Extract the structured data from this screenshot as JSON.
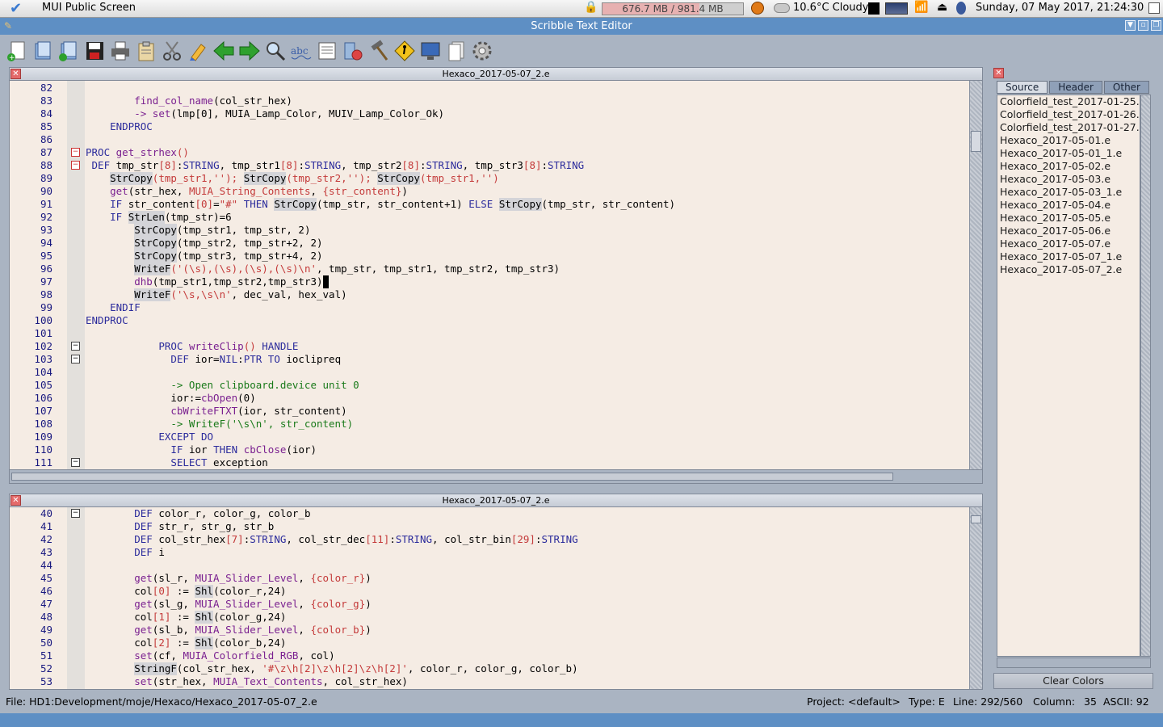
{
  "screen": {
    "title": "MUI Public Screen",
    "memory": "676.7 MB / 981.4 MB",
    "memory_fraction": 0.69,
    "weather": "10.6°C Cloudy",
    "datetime": "Sunday, 07 May 2017, 21:24:30"
  },
  "window": {
    "title": "Scribble Text Editor"
  },
  "toolbar": {
    "buttons": [
      "new-file",
      "open-file",
      "open-add",
      "save",
      "print",
      "paste",
      "cut",
      "highlight",
      "back",
      "forward",
      "find",
      "spell-check",
      "preview",
      "plugins",
      "build",
      "run",
      "monitor",
      "documents",
      "settings"
    ]
  },
  "pane_top": {
    "title": "Hexaco_2017-05-07_2.e",
    "lines": [
      {
        "n": "82",
        "t": []
      },
      {
        "n": "83",
        "t": [
          [
            "",
            "        "
          ],
          [
            "fn",
            "find_col_name"
          ],
          [
            "",
            "(col_str_hex)"
          ]
        ]
      },
      {
        "n": "84",
        "t": [
          [
            "",
            "        "
          ],
          [
            "fn",
            "-> set"
          ],
          [
            "",
            "("
          ],
          [
            "",
            "lmp[0], MUIA_Lamp_Color, MUIV_Lamp_Color_Ok"
          ],
          [
            "",
            ")"
          ]
        ]
      },
      {
        "n": "85",
        "t": [
          [
            "",
            "    "
          ],
          [
            "kw",
            "ENDPROC"
          ]
        ]
      },
      {
        "n": "86",
        "t": []
      },
      {
        "n": "87",
        "t": [
          [
            "kw",
            "PROC"
          ],
          [
            "",
            " "
          ],
          [
            "fn",
            "get_strhex"
          ],
          [
            "str",
            "()"
          ]
        ]
      },
      {
        "n": "88",
        "t": [
          [
            "",
            " "
          ],
          [
            "kw",
            "DEF"
          ],
          [
            "",
            " tmp_str"
          ],
          [
            "str",
            "[8]"
          ],
          [
            "",
            ":"
          ],
          [
            "kw",
            "STRING"
          ],
          [
            "",
            ", tmp_str1"
          ],
          [
            "str",
            "[8]"
          ],
          [
            "",
            ":"
          ],
          [
            "kw",
            "STRING"
          ],
          [
            "",
            ", tmp_str2"
          ],
          [
            "str",
            "[8]"
          ],
          [
            "",
            ":"
          ],
          [
            "kw",
            "STRING"
          ],
          [
            "",
            ", tmp_str3"
          ],
          [
            "str",
            "[8]"
          ],
          [
            "",
            ":"
          ],
          [
            "kw",
            "STRING"
          ]
        ]
      },
      {
        "n": "89",
        "t": [
          [
            "",
            "    "
          ],
          [
            "hl",
            "StrCopy"
          ],
          [
            "str",
            "(tmp_str1,'');"
          ],
          [
            "",
            " "
          ],
          [
            "hl",
            "StrCopy"
          ],
          [
            "str",
            "(tmp_str2,'');"
          ],
          [
            "",
            " "
          ],
          [
            "hl",
            "StrCopy"
          ],
          [
            "str",
            "(tmp_str1,'')"
          ]
        ]
      },
      {
        "n": "90",
        "t": [
          [
            "",
            "    "
          ],
          [
            "fn",
            "get"
          ],
          [
            "",
            "(str_hex, "
          ],
          [
            "str",
            "MUIA_String_Contents"
          ],
          [
            "",
            ", "
          ],
          [
            "str",
            "{str_content}"
          ],
          [
            "",
            ")"
          ]
        ]
      },
      {
        "n": "91",
        "t": [
          [
            "",
            "    "
          ],
          [
            "kw",
            "IF"
          ],
          [
            "",
            " str_content"
          ],
          [
            "str",
            "[0]"
          ],
          [
            "",
            "="
          ],
          [
            "str",
            "\"#\""
          ],
          [
            "",
            " "
          ],
          [
            "kw",
            "THEN"
          ],
          [
            "",
            " "
          ],
          [
            "hl",
            "StrCopy"
          ],
          [
            "",
            "(tmp_str, str_content+1) "
          ],
          [
            "kw",
            "ELSE"
          ],
          [
            "",
            " "
          ],
          [
            "hl",
            "StrCopy"
          ],
          [
            "",
            "(tmp_str, str_content)"
          ]
        ]
      },
      {
        "n": "92",
        "t": [
          [
            "",
            "    "
          ],
          [
            "kw",
            "IF"
          ],
          [
            "",
            " "
          ],
          [
            "hl",
            "StrLen"
          ],
          [
            "",
            "(tmp_str)=6"
          ]
        ]
      },
      {
        "n": "93",
        "t": [
          [
            "",
            "        "
          ],
          [
            "hl",
            "StrCopy"
          ],
          [
            "",
            "(tmp_str1, tmp_str, 2)"
          ]
        ]
      },
      {
        "n": "94",
        "t": [
          [
            "",
            "        "
          ],
          [
            "hl",
            "StrCopy"
          ],
          [
            "",
            "(tmp_str2, tmp_str+2, 2)"
          ]
        ]
      },
      {
        "n": "95",
        "t": [
          [
            "",
            "        "
          ],
          [
            "hl",
            "StrCopy"
          ],
          [
            "",
            "(tmp_str3, tmp_str+4, 2)"
          ]
        ]
      },
      {
        "n": "96",
        "t": [
          [
            "",
            "        "
          ],
          [
            "hl",
            "WriteF"
          ],
          [
            "str",
            "('(\\s),(\\s),(\\s),(\\s)\\n'"
          ],
          [
            "",
            ", tmp_str, tmp_str1, tmp_str2, tmp_str3)"
          ]
        ]
      },
      {
        "n": "97",
        "t": [
          [
            "",
            "        "
          ],
          [
            "fn",
            "dhb"
          ],
          [
            "",
            "(tmp_str1,tmp_str2,tmp_str3)"
          ],
          [
            "cursor",
            " "
          ]
        ]
      },
      {
        "n": "98",
        "t": [
          [
            "",
            "        "
          ],
          [
            "hl",
            "WriteF"
          ],
          [
            "str",
            "('\\s,\\s\\n'"
          ],
          [
            "",
            ", dec_val, hex_val)"
          ]
        ]
      },
      {
        "n": "99",
        "t": [
          [
            "",
            "    "
          ],
          [
            "kw",
            "ENDIF"
          ]
        ]
      },
      {
        "n": "100",
        "t": [
          [
            "kw",
            "ENDPROC"
          ]
        ]
      },
      {
        "n": "101",
        "t": []
      },
      {
        "n": "102",
        "t": [
          [
            "",
            "            "
          ],
          [
            "kw",
            "PROC"
          ],
          [
            "",
            " "
          ],
          [
            "fn",
            "writeClip"
          ],
          [
            "str",
            "()"
          ],
          [
            "",
            " "
          ],
          [
            "kw",
            "HANDLE"
          ]
        ]
      },
      {
        "n": "103",
        "t": [
          [
            "",
            "              "
          ],
          [
            "kw",
            "DEF"
          ],
          [
            "",
            " ior="
          ],
          [
            "kw",
            "NIL"
          ],
          [
            "",
            ":"
          ],
          [
            "kw",
            "PTR TO"
          ],
          [
            "",
            " ioclipreq"
          ]
        ]
      },
      {
        "n": "104",
        "t": []
      },
      {
        "n": "105",
        "t": [
          [
            "",
            "              "
          ],
          [
            "cm",
            "-> Open clipboard.device unit 0"
          ]
        ]
      },
      {
        "n": "106",
        "t": [
          [
            "",
            "              "
          ],
          [
            "",
            "ior:="
          ],
          [
            "fn",
            "cbOpen"
          ],
          [
            "",
            "(0)"
          ]
        ]
      },
      {
        "n": "107",
        "t": [
          [
            "",
            "              "
          ],
          [
            "fn",
            "cbWriteFTXT"
          ],
          [
            "",
            "(ior, str_content)"
          ]
        ]
      },
      {
        "n": "108",
        "t": [
          [
            "",
            "              "
          ],
          [
            "cm",
            "-> WriteF('\\s\\n', str_content)"
          ]
        ]
      },
      {
        "n": "109",
        "t": [
          [
            "",
            "            "
          ],
          [
            "kw",
            "EXCEPT DO"
          ]
        ]
      },
      {
        "n": "110",
        "t": [
          [
            "",
            "              "
          ],
          [
            "kw",
            "IF"
          ],
          [
            "",
            " ior "
          ],
          [
            "kw",
            "THEN"
          ],
          [
            "",
            " "
          ],
          [
            "fn",
            "cbClose"
          ],
          [
            "",
            "(ior)"
          ]
        ]
      },
      {
        "n": "111",
        "t": [
          [
            "",
            "              "
          ],
          [
            "kw",
            "SELECT"
          ],
          [
            "",
            " exception"
          ]
        ]
      }
    ]
  },
  "pane_bottom": {
    "title": "Hexaco_2017-05-07_2.e",
    "lines": [
      {
        "n": "40",
        "t": [
          [
            "",
            "        "
          ],
          [
            "kw",
            "DEF"
          ],
          [
            "",
            " color_r, color_g, color_b"
          ]
        ]
      },
      {
        "n": "41",
        "t": [
          [
            "",
            "        "
          ],
          [
            "kw",
            "DEF"
          ],
          [
            "",
            " str_r, str_g, str_b"
          ]
        ]
      },
      {
        "n": "42",
        "t": [
          [
            "",
            "        "
          ],
          [
            "kw",
            "DEF"
          ],
          [
            "",
            " col_str_hex"
          ],
          [
            "str",
            "[7]"
          ],
          [
            "",
            ":"
          ],
          [
            "kw",
            "STRING"
          ],
          [
            "",
            ", col_str_dec"
          ],
          [
            "str",
            "[11]"
          ],
          [
            "",
            ":"
          ],
          [
            "kw",
            "STRING"
          ],
          [
            "",
            ", col_str_bin"
          ],
          [
            "str",
            "[29]"
          ],
          [
            "",
            ":"
          ],
          [
            "kw",
            "STRING"
          ]
        ]
      },
      {
        "n": "43",
        "t": [
          [
            "",
            "        "
          ],
          [
            "kw",
            "DEF"
          ],
          [
            "",
            " i"
          ]
        ]
      },
      {
        "n": "44",
        "t": []
      },
      {
        "n": "45",
        "t": [
          [
            "",
            "        "
          ],
          [
            "fn",
            "get"
          ],
          [
            "",
            "(sl_r, "
          ],
          [
            "fn",
            "MUIA_Slider_Level"
          ],
          [
            "",
            ", "
          ],
          [
            "str",
            "{color_r}"
          ],
          [
            "",
            ")"
          ]
        ]
      },
      {
        "n": "46",
        "t": [
          [
            "",
            "        "
          ],
          [
            "",
            "col"
          ],
          [
            "str",
            "[0]"
          ],
          [
            "",
            " := "
          ],
          [
            "hl",
            "Shl"
          ],
          [
            "",
            "(color_r,24)"
          ]
        ]
      },
      {
        "n": "47",
        "t": [
          [
            "",
            "        "
          ],
          [
            "fn",
            "get"
          ],
          [
            "",
            "(sl_g, "
          ],
          [
            "fn",
            "MUIA_Slider_Level"
          ],
          [
            "",
            ", "
          ],
          [
            "str",
            "{color_g}"
          ],
          [
            "",
            ")"
          ]
        ]
      },
      {
        "n": "48",
        "t": [
          [
            "",
            "        "
          ],
          [
            "",
            "col"
          ],
          [
            "str",
            "[1]"
          ],
          [
            "",
            " := "
          ],
          [
            "hl",
            "Shl"
          ],
          [
            "",
            "(color_g,24)"
          ]
        ]
      },
      {
        "n": "49",
        "t": [
          [
            "",
            "        "
          ],
          [
            "fn",
            "get"
          ],
          [
            "",
            "(sl_b, "
          ],
          [
            "fn",
            "MUIA_Slider_Level"
          ],
          [
            "",
            ", "
          ],
          [
            "str",
            "{color_b}"
          ],
          [
            "",
            ")"
          ]
        ]
      },
      {
        "n": "50",
        "t": [
          [
            "",
            "        "
          ],
          [
            "",
            "col"
          ],
          [
            "str",
            "[2]"
          ],
          [
            "",
            " := "
          ],
          [
            "hl",
            "Shl"
          ],
          [
            "",
            "(color_b,24)"
          ]
        ]
      },
      {
        "n": "51",
        "t": [
          [
            "",
            "        "
          ],
          [
            "fn",
            "set"
          ],
          [
            "",
            "(cf, "
          ],
          [
            "fn",
            "MUIA_Colorfield_RGB"
          ],
          [
            "",
            ", col)"
          ]
        ]
      },
      {
        "n": "52",
        "t": [
          [
            "",
            "        "
          ],
          [
            "hl",
            "StringF"
          ],
          [
            "",
            "(col_str_hex, "
          ],
          [
            "str",
            "'#\\z\\h[2]\\z\\h[2]\\z\\h[2]'"
          ],
          [
            "",
            ", color_r, color_g, color_b)"
          ]
        ]
      },
      {
        "n": "53",
        "t": [
          [
            "",
            "        "
          ],
          [
            "fn",
            "set"
          ],
          [
            "",
            "(str_hex, "
          ],
          [
            "fn",
            "MUIA_Text_Contents"
          ],
          [
            "",
            ", col_str_hex)"
          ]
        ]
      }
    ]
  },
  "right_panel": {
    "tabs": [
      "Source",
      "Header",
      "Other"
    ],
    "files": [
      "Colorfield_test_2017-01-25.",
      "Colorfield_test_2017-01-26.",
      "Colorfield_test_2017-01-27.",
      "Hexaco_2017-05-01.e",
      "Hexaco_2017-05-01_1.e",
      "Hexaco_2017-05-02.e",
      "Hexaco_2017-05-03.e",
      "Hexaco_2017-05-03_1.e",
      "Hexaco_2017-05-04.e",
      "Hexaco_2017-05-05.e",
      "Hexaco_2017-05-06.e",
      "Hexaco_2017-05-07.e",
      "Hexaco_2017-05-07_1.e",
      "Hexaco_2017-05-07_2.e"
    ],
    "clear_button": "Clear Colors"
  },
  "status": {
    "file": "File: HD1:Development/moje/Hexaco/Hexaco_2017-05-07_2.e",
    "project": "Project: <default>",
    "type": "Type: E",
    "line": "Line: 292/560",
    "column": "Column:",
    "column_value": "35",
    "ascii": "ASCII: 92"
  },
  "colors": {
    "keyword": "#2c2c9c",
    "function": "#7a2090",
    "string": "#c43a3a",
    "comment": "#1a7a1a",
    "editor_bg": "#f5ece4",
    "titlebar": "#5e8fc4"
  }
}
